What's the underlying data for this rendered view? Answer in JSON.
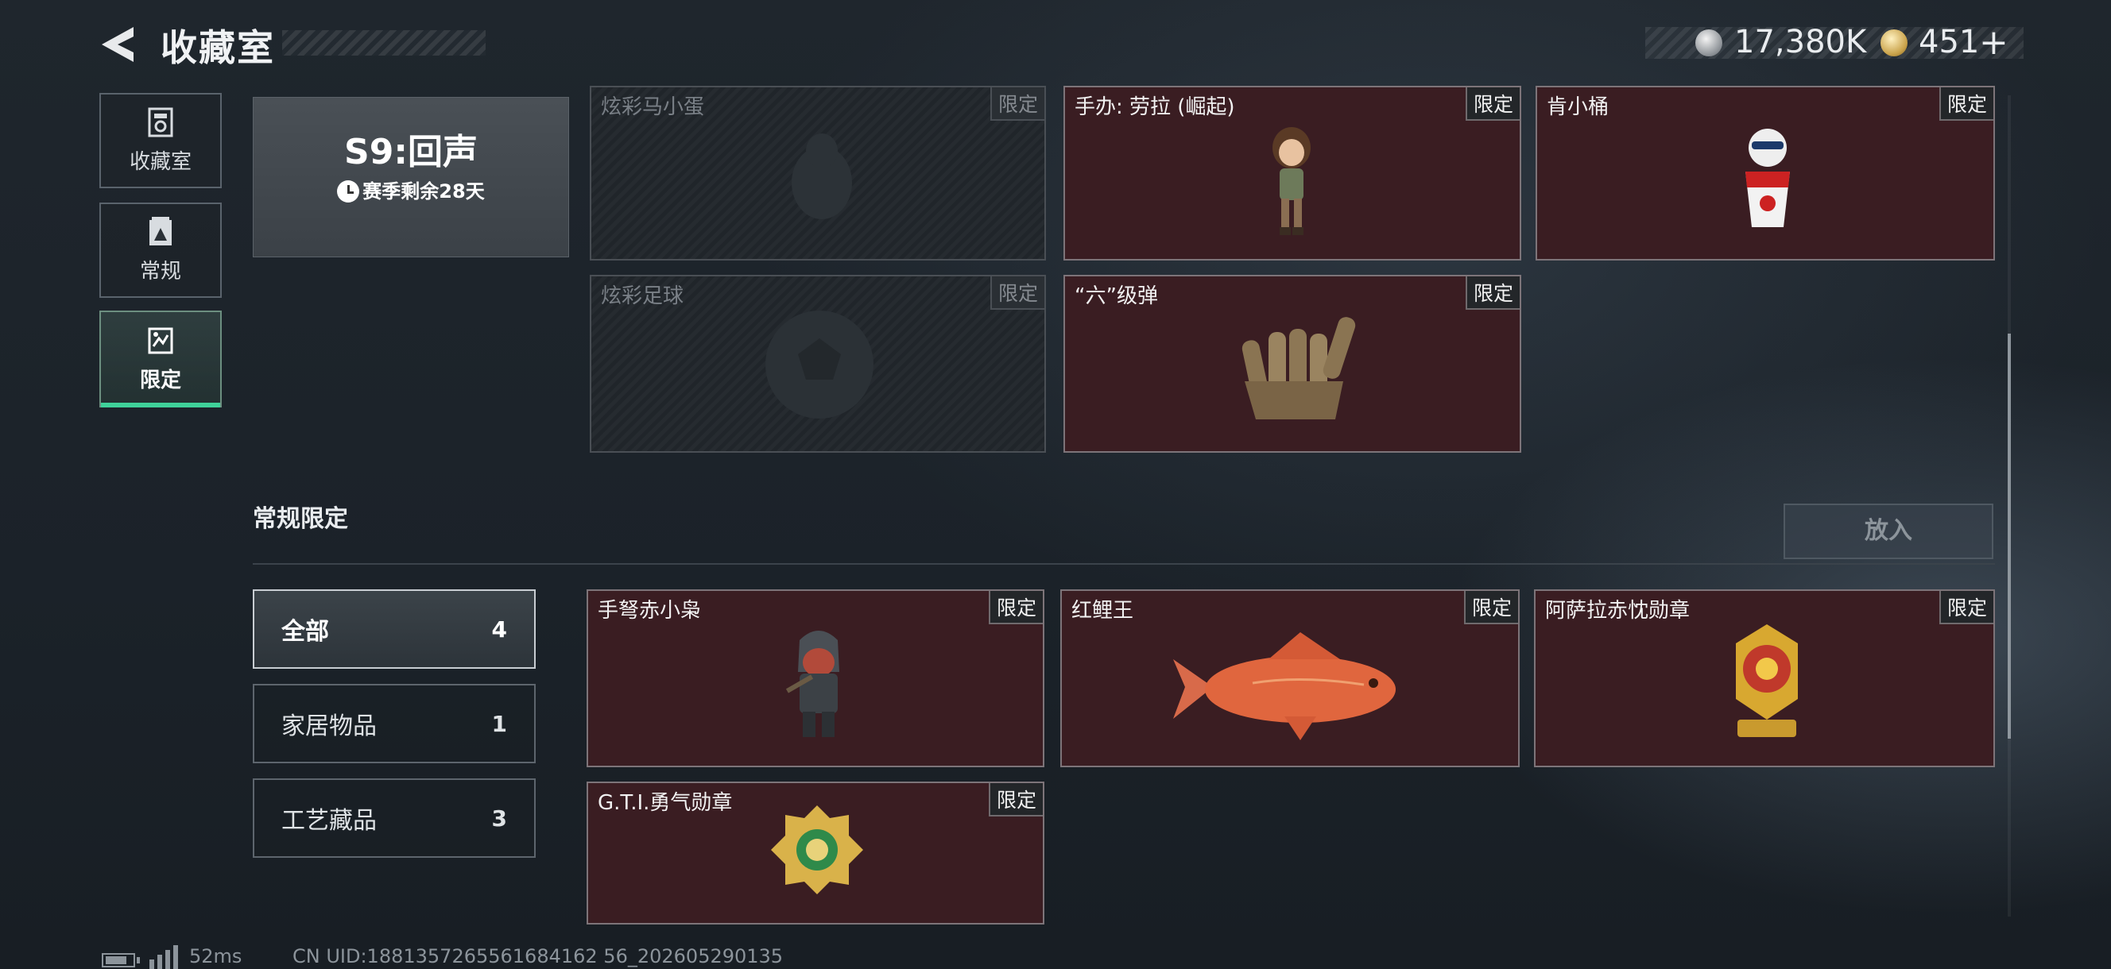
{
  "header": {
    "title": "收藏室",
    "currencies": [
      {
        "icon": "silver-coin-icon",
        "value": "17,380K"
      },
      {
        "icon": "gold-coin-icon",
        "value": "451"
      }
    ],
    "add_symbol": "+"
  },
  "sidebar": {
    "items": [
      {
        "label": "收藏室",
        "icon": "collection-room-icon",
        "active": false
      },
      {
        "label": "常规",
        "icon": "regular-gallery-icon",
        "active": false
      },
      {
        "label": "限定",
        "icon": "limited-gallery-icon",
        "active": true
      }
    ]
  },
  "season": {
    "title": "S9:回声",
    "remaining": "赛季剩余28天"
  },
  "top_grid": [
    {
      "name": "炫彩马小蛋",
      "tag": "限定",
      "owned": false
    },
    {
      "name": "手办: 劳拉 (崛起)",
      "tag": "限定",
      "owned": true
    },
    {
      "name": "肯小桶",
      "tag": "限定",
      "owned": true
    },
    {
      "name": "炫彩足球",
      "tag": "限定",
      "owned": false
    },
    {
      "name": "“六”级弹",
      "tag": "限定",
      "owned": true
    }
  ],
  "section": {
    "title": "常规限定",
    "put_button": "放入"
  },
  "filters": [
    {
      "label": "全部",
      "count": "4",
      "active": true
    },
    {
      "label": "家居物品",
      "count": "1",
      "active": false
    },
    {
      "label": "工艺藏品",
      "count": "3",
      "active": false
    }
  ],
  "bottom_grid": [
    {
      "name": "手弩赤小枭",
      "tag": "限定"
    },
    {
      "name": "红鲤王",
      "tag": "限定"
    },
    {
      "name": "阿萨拉赤忱勋章",
      "tag": "限定"
    },
    {
      "name": "G.T.I.勇气勋章",
      "tag": "限定"
    }
  ],
  "status_bar": {
    "ping": "52ms",
    "uid": "CN UID:1881357265561684162 56_202605290135"
  },
  "colors": {
    "accent": "#3fd29a",
    "card_bg": "#3a1d22",
    "background": "#1d242b"
  }
}
